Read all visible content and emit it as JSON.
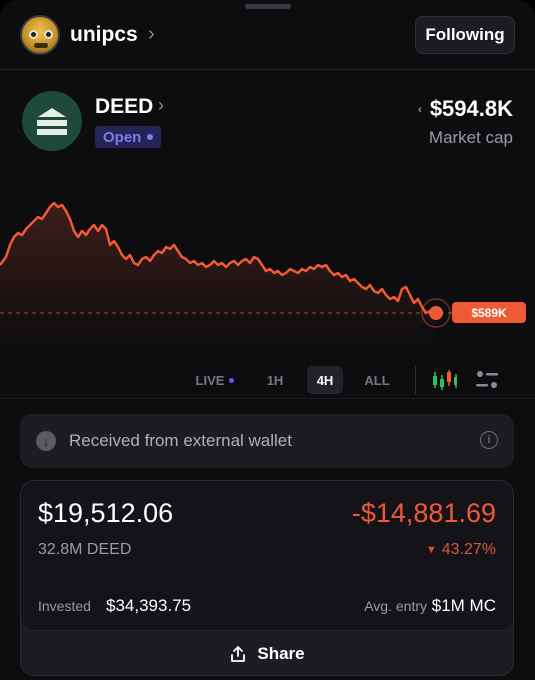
{
  "header": {
    "username": "unipcs",
    "chevron": "›",
    "follow_label": "Following",
    "avatar_icon": "robot-avatar-icon"
  },
  "token": {
    "name": "DEED",
    "chevron": "›",
    "status": "Open",
    "logo_icon": "stacked-bars-logo-icon",
    "market_cap": "$594.8K",
    "market_cap_label": "Market cap",
    "sort_icon": "sort-updown-icon"
  },
  "chart": {
    "current_price_label": "$589K",
    "line_color": "#ee5a36"
  },
  "timeframes": {
    "live": "LIVE",
    "h1": "1H",
    "h4": "4H",
    "all": "ALL",
    "selected": "4H"
  },
  "received": {
    "text": "Received from external wallet",
    "icon": "arrow-down-circle-icon",
    "info_icon": "info-icon"
  },
  "position": {
    "balance": "$19,512.06",
    "pnl": "-$14,881.69",
    "amount": "32.8M DEED",
    "pnl_pct": "43.27%",
    "invested_label": "Invested",
    "invested_value": "$34,393.75",
    "avg_label": "Avg. entry",
    "avg_value": "$1M MC"
  },
  "share": {
    "label": "Share",
    "icon": "share-upload-icon"
  },
  "colors": {
    "accent_red": "#ee5a36",
    "open_badge": "#7d7df0",
    "token_logo": "#1d4a3a"
  }
}
